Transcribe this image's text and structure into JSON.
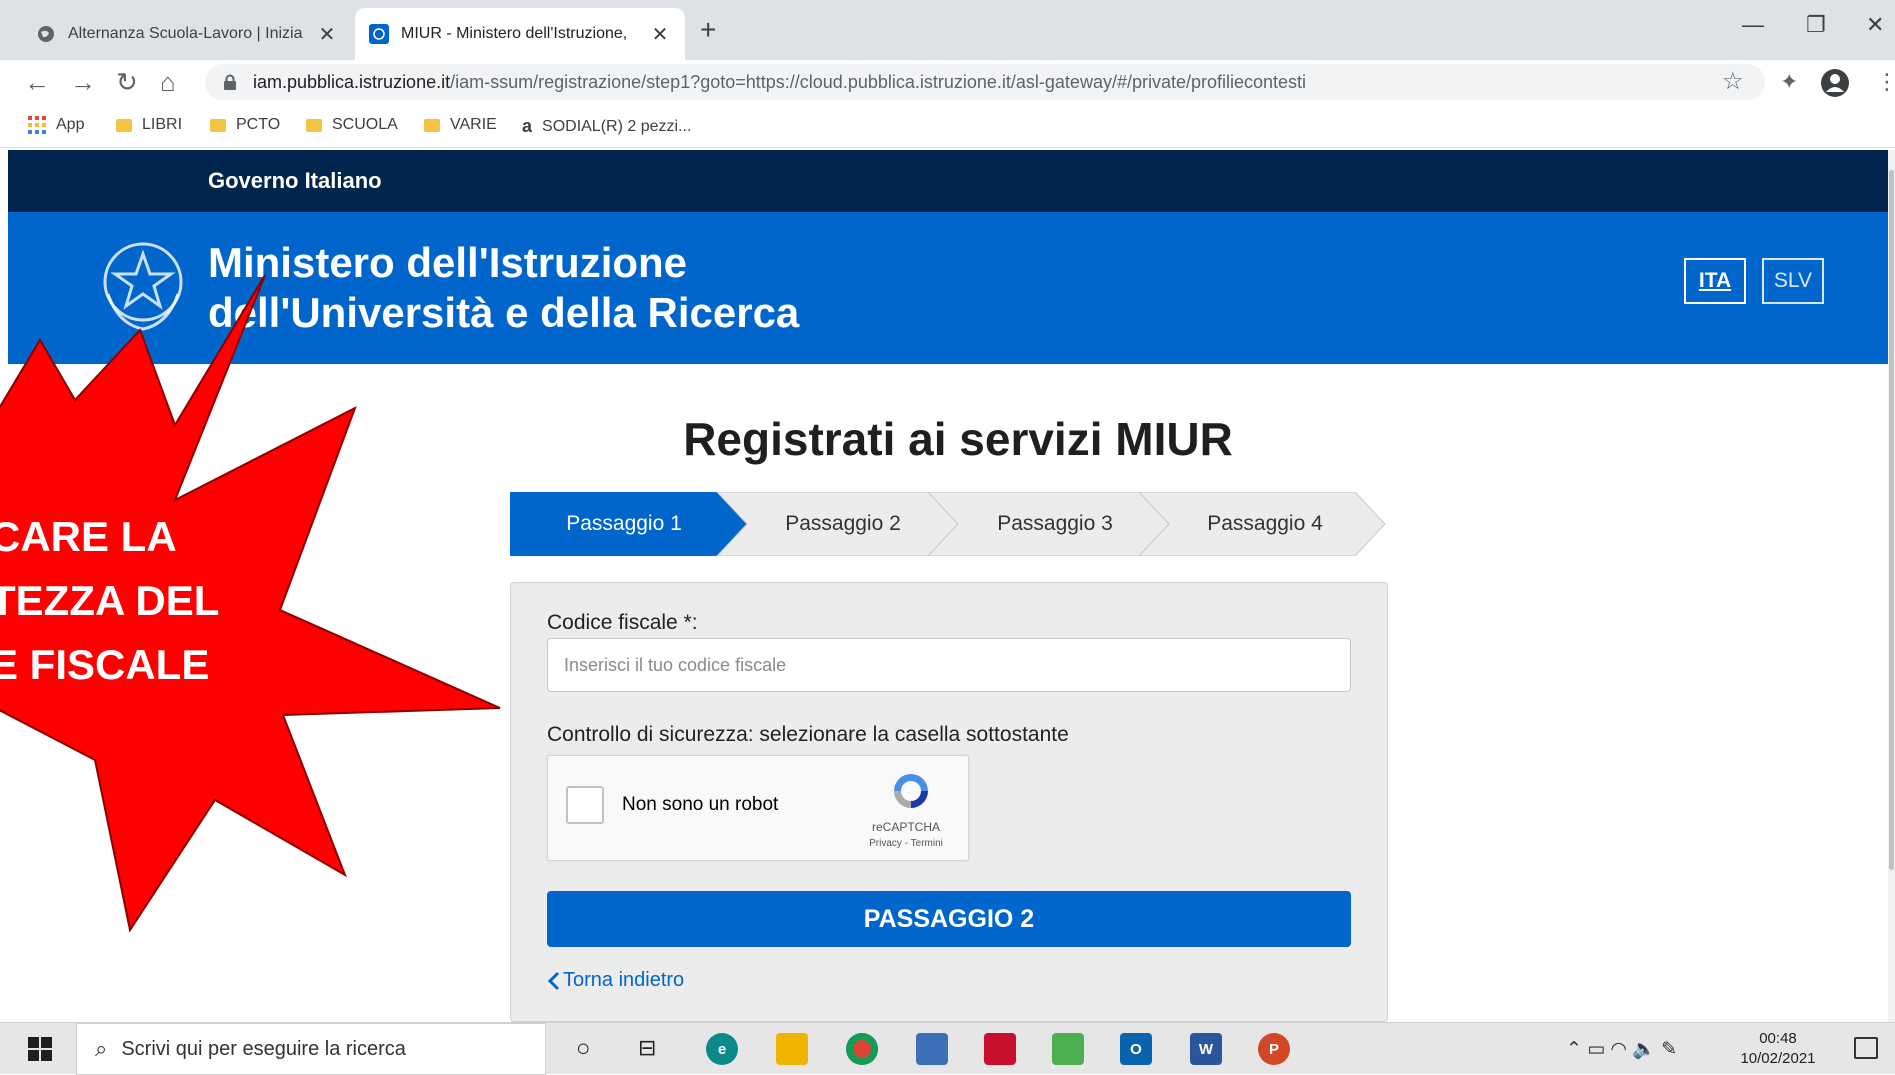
{
  "browser": {
    "tabs": [
      {
        "title": "Alternanza Scuola-Lavoro | Inizia",
        "active": false
      },
      {
        "title": "MIUR - Ministero dell'Istruzione,",
        "active": true
      }
    ],
    "new_tab": "+",
    "window_controls": {
      "minimize": "—",
      "restore": "❐",
      "close": "✕"
    },
    "url_host": "iam.pubblica.istruzione.it",
    "url_path": "/iam-ssum/registrazione/step1?goto=https://cloud.pubblica.istruzione.it/asl-gateway/#/private/profiliecontesti",
    "bookmarks": [
      {
        "label": "App",
        "icon": "apps-grid-icon"
      },
      {
        "label": "LIBRI",
        "icon": "folder-icon"
      },
      {
        "label": "PCTO",
        "icon": "folder-icon"
      },
      {
        "label": "SCUOLA",
        "icon": "folder-icon"
      },
      {
        "label": "VARIE",
        "icon": "folder-icon"
      },
      {
        "label": "SODIAL(R) 2 pezzi...",
        "icon": "amazon-icon"
      }
    ]
  },
  "header": {
    "gov_label": "Governo Italiano",
    "ministry_line1": "Ministero dell'Istruzione",
    "ministry_line2": "dell'Università e della Ricerca",
    "lang_ita": "ITA",
    "lang_slv": "SLV"
  },
  "main": {
    "title": "Registrati ai servizi MIUR",
    "steps": [
      "Passaggio 1",
      "Passaggio 2",
      "Passaggio 3",
      "Passaggio 4"
    ],
    "active_step": 1,
    "form": {
      "cf_label": "Codice fiscale *:",
      "cf_placeholder": "Inserisci il tuo codice fiscale",
      "security_label": "Controllo di sicurezza: selezionare la casella sottostante",
      "captcha_label": "Non sono un robot",
      "captcha_brand": "reCAPTCHA",
      "captcha_links": "Privacy - Termini",
      "submit_label": "PASSAGGIO 2",
      "back_label": "Torna indietro"
    }
  },
  "annotation": {
    "text": "CARE LA\nTEZZA DEL\nE FISCALE",
    "color": "#ff0000"
  },
  "taskbar": {
    "search_placeholder": "Scrivi qui per eseguire la ricerca",
    "time": "00:48",
    "date": "10/02/2021"
  },
  "colors": {
    "gov_bar": "#00264d",
    "ministry_bar": "#0066cc",
    "primary_button": "#0066cc"
  }
}
